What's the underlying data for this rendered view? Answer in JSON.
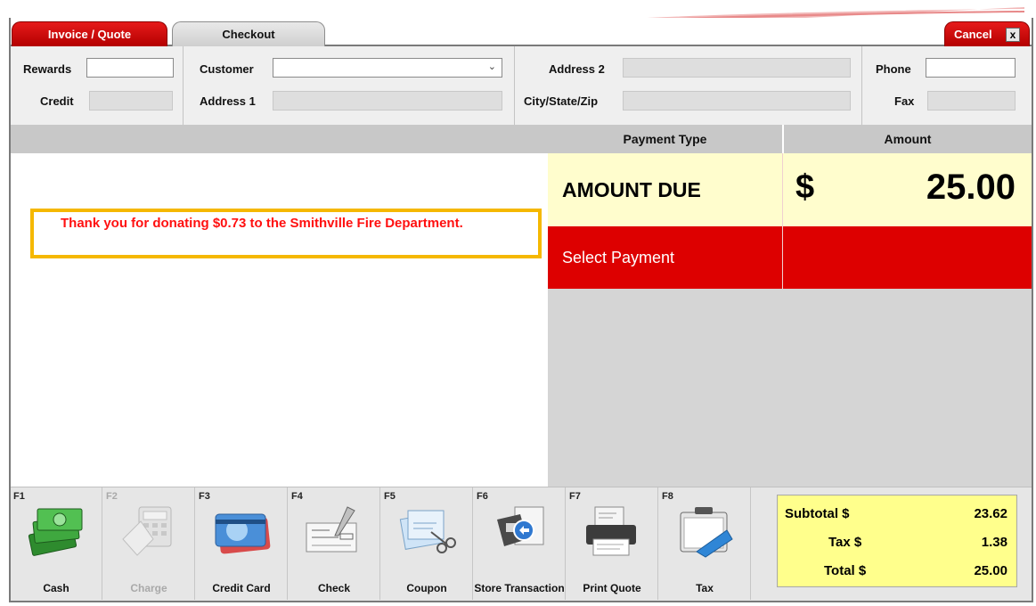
{
  "tabs": {
    "invoice_quote": "Invoice / Quote",
    "checkout": "Checkout",
    "cancel": "Cancel",
    "cancel_close_icon": "x"
  },
  "customer_panel": {
    "rewards_label": "Rewards",
    "rewards_value": "",
    "credit_label": "Credit",
    "credit_value": "",
    "customer_label": "Customer",
    "customer_value": "",
    "address1_label": "Address 1",
    "address1_value": "",
    "address2_label": "Address 2",
    "address2_value": "",
    "city_state_zip_label": "City/State/Zip",
    "city_state_zip_value": "",
    "phone_label": "Phone",
    "phone_value": "",
    "fax_label": "Fax",
    "fax_value": ""
  },
  "grid": {
    "payment_type_header": "Payment Type",
    "amount_header": "Amount"
  },
  "message": {
    "donation_text": "Thank you for donating $0.73 to the Smithville Fire Department."
  },
  "payment": {
    "amount_due_label": "AMOUNT DUE",
    "currency_symbol": "$",
    "amount_due_value": "25.00",
    "select_payment_label": "Select Payment"
  },
  "function_keys": [
    {
      "key": "F1",
      "label": "Cash",
      "icon": "cash-icon",
      "enabled": true
    },
    {
      "key": "F2",
      "label": "Charge",
      "icon": "charge-icon",
      "enabled": false
    },
    {
      "key": "F3",
      "label": "Credit Card",
      "icon": "credit-card-icon",
      "enabled": true
    },
    {
      "key": "F4",
      "label": "Check",
      "icon": "check-icon",
      "enabled": true
    },
    {
      "key": "F5",
      "label": "Coupon",
      "icon": "coupon-icon",
      "enabled": true
    },
    {
      "key": "F6",
      "label": "Store Transaction",
      "icon": "store-transaction-icon",
      "enabled": true
    },
    {
      "key": "F7",
      "label": "Print Quote",
      "icon": "printer-icon",
      "enabled": true
    },
    {
      "key": "F8",
      "label": "Tax",
      "icon": "tax-icon",
      "enabled": true
    }
  ],
  "totals": {
    "subtotal_label": "Subtotal $",
    "subtotal_value": "23.62",
    "tax_label": "Tax $",
    "tax_value": "1.38",
    "total_label": "Total $",
    "total_value": "25.00"
  },
  "colors": {
    "accent_red": "#dd0000",
    "amount_due_bg": "#fffdcd",
    "totals_bg": "#ffff8c",
    "donation_border": "#f5b800",
    "donation_text": "#ff1010"
  }
}
